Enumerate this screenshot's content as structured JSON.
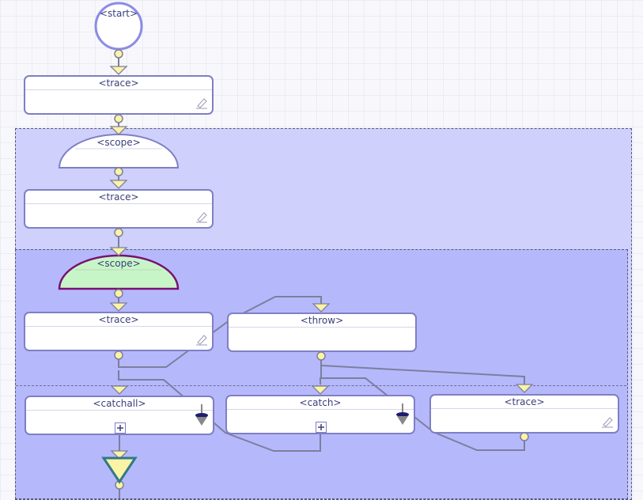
{
  "nodes": {
    "start": "<start>",
    "trace1": "<trace>",
    "scope1": "<scope>",
    "trace2": "<trace>",
    "scope2": "<scope>",
    "trace3": "<trace>",
    "throw": "<throw>",
    "catchall": "<catchall>",
    "catch": "<catch>",
    "trace4": "<trace>"
  },
  "icons": {
    "edit": "pencil-icon",
    "fault": "fault-handler-icon",
    "expand": "expand-plus-icon",
    "end": "end-triangle-icon"
  },
  "colors": {
    "outer_scope_fill": "#cfd0fc",
    "inner_scope_fill": "#b6b8fc",
    "node_border": "#7f7fc4",
    "selected_scope_fill": "#c8f5c8",
    "selected_scope_border": "#7a1070",
    "connector_fill": "#fbf3a6",
    "link_color": "#7c7f9c"
  }
}
